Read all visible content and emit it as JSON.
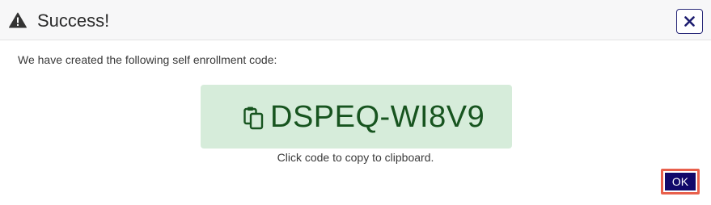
{
  "header": {
    "title": "Success!",
    "icon": "warning-icon",
    "close_icon": "close-icon"
  },
  "body": {
    "message": "We have created the following self enrollment code:",
    "code": "DSPEQ-WI8V9",
    "code_icon": "clipboard-icon",
    "hint": "Click code to copy to clipboard."
  },
  "footer": {
    "ok_label": "OK"
  },
  "colors": {
    "code_background": "#d6ecda",
    "code_text": "#17541f",
    "ok_button": "#11086a",
    "focus_outline": "#e8604c"
  }
}
